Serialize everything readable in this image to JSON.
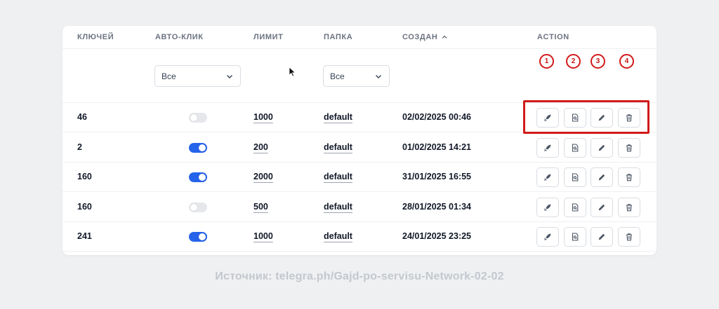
{
  "table": {
    "headers": {
      "keys": "КЛЮЧЕЙ",
      "auto_click": "АВТО-КЛИК",
      "limit": "ЛИМИТ",
      "folder": "ПАПКА",
      "created": "СОЗДАН",
      "action": "ACTION"
    },
    "filters": {
      "auto_click_value": "Все",
      "folder_value": "Все"
    },
    "markers": [
      "1",
      "2",
      "3",
      "4"
    ],
    "rows": [
      {
        "keys": "46",
        "auto_click": false,
        "limit": "1000",
        "folder": "default",
        "created": "02/02/2025 00:46"
      },
      {
        "keys": "2",
        "auto_click": true,
        "limit": "200",
        "folder": "default",
        "created": "01/02/2025 14:21"
      },
      {
        "keys": "160",
        "auto_click": true,
        "limit": "2000",
        "folder": "default",
        "created": "31/01/2025 16:55"
      },
      {
        "keys": "160",
        "auto_click": false,
        "limit": "500",
        "folder": "default",
        "created": "28/01/2025 01:34"
      },
      {
        "keys": "241",
        "auto_click": true,
        "limit": "1000",
        "folder": "default",
        "created": "24/01/2025 23:25"
      }
    ],
    "action_icons": [
      "rocket-icon",
      "document-search-icon",
      "pencil-icon",
      "trash-icon"
    ]
  },
  "caption": "Источник: telegra.ph/Gajd-po-servisu-Network-02-02",
  "colors": {
    "toggle_on": "#2563eb",
    "highlight": "#d11a1a",
    "background": "#eff0f2"
  }
}
